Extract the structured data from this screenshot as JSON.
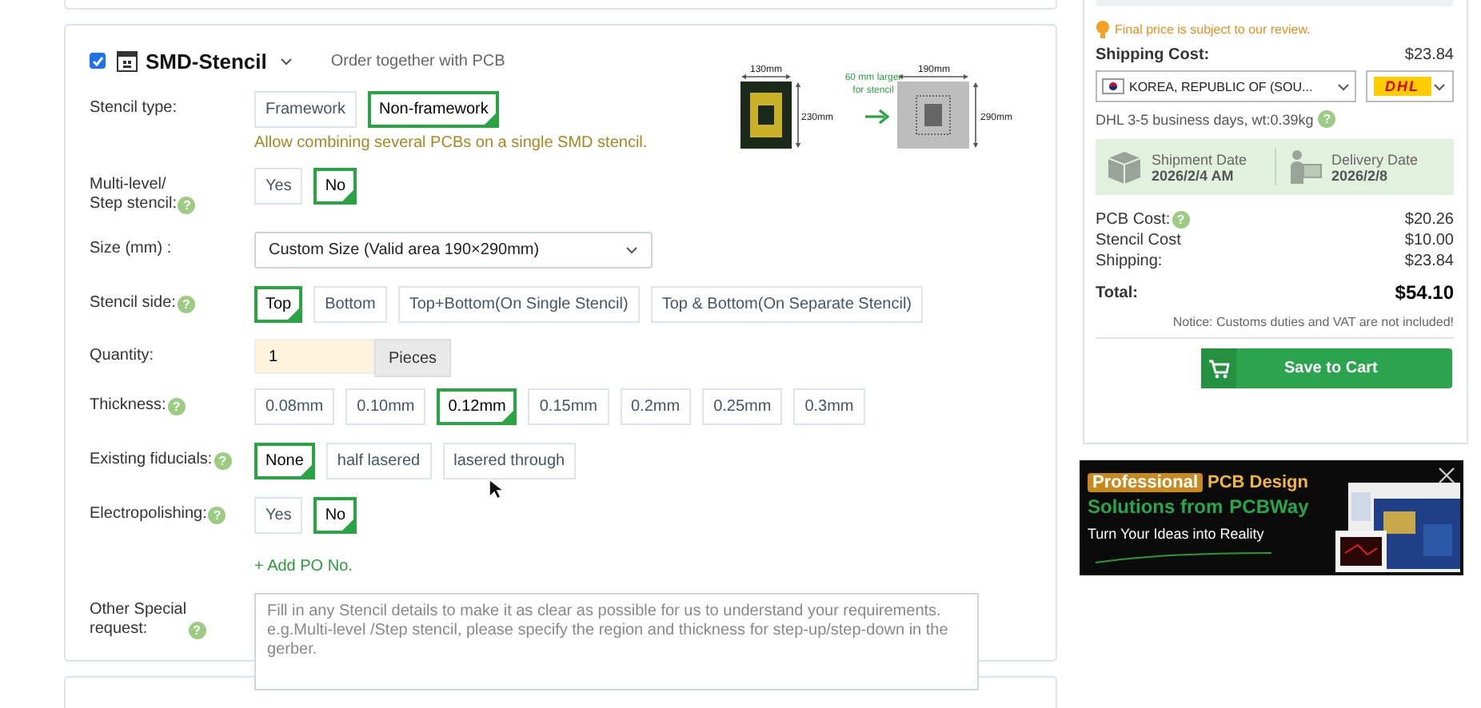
{
  "stencil": {
    "checked": true,
    "title": "SMD-Stencil",
    "subtitle": "Order together with PCB",
    "diagram": {
      "pcb_width": "130mm",
      "pcb_height": "230mm",
      "note": [
        "60 mm larger",
        "for stencil"
      ],
      "stencil_width": "190mm",
      "stencil_height": "290mm"
    },
    "fields": [
      {
        "kind": "options",
        "label": "Stencil type:",
        "options": [
          {
            "label": "Framework",
            "selected": false
          },
          {
            "label": "Non-framework",
            "selected": true
          }
        ],
        "note": "Allow combining several PCBs on a single SMD stencil."
      },
      {
        "kind": "options",
        "label": "Multi-level/\nStep stencil:",
        "help": "?",
        "options": [
          {
            "label": "Yes",
            "selected": false
          },
          {
            "label": "No",
            "selected": true
          }
        ]
      },
      {
        "kind": "select",
        "label": "Size (mm) :",
        "value": "Custom Size  (Valid area 190×290mm)"
      },
      {
        "kind": "options",
        "label": "Stencil side:",
        "help": "?",
        "options": [
          {
            "label": "Top",
            "selected": true
          },
          {
            "label": "Bottom",
            "selected": false
          },
          {
            "label": "Top+Bottom(On Single Stencil)",
            "selected": false
          },
          {
            "label": "Top & Bottom(On Separate Stencil)",
            "selected": false
          }
        ]
      },
      {
        "kind": "quantity",
        "label": "Quantity:",
        "value": "1",
        "unit": "Pieces"
      },
      {
        "kind": "options",
        "label": "Thickness:",
        "help": "?",
        "options": [
          {
            "label": "0.08mm",
            "selected": false
          },
          {
            "label": "0.10mm",
            "selected": false
          },
          {
            "label": "0.12mm",
            "selected": true
          },
          {
            "label": "0.15mm",
            "selected": false
          },
          {
            "label": "0.2mm",
            "selected": false
          },
          {
            "label": "0.25mm",
            "selected": false
          },
          {
            "label": "0.3mm",
            "selected": false
          }
        ]
      },
      {
        "kind": "options",
        "label": "Existing fiducials:",
        "help": "?",
        "options": [
          {
            "label": "None",
            "selected": true
          },
          {
            "label": "half lasered",
            "selected": false
          },
          {
            "label": "lasered through",
            "selected": false
          }
        ]
      },
      {
        "kind": "options",
        "label": "Electropolishing:",
        "help": "?",
        "options": [
          {
            "label": "Yes",
            "selected": false
          },
          {
            "label": "No",
            "selected": true
          }
        ]
      },
      {
        "kind": "link",
        "text": "+ Add PO No."
      },
      {
        "kind": "textarea",
        "label": "Other Special\nrequest:",
        "help": "?",
        "placeholder": "Fill in any Stencil details to make it as clear as possible for us to understand your requirements. e.g.Multi-level /Step stencil, please specify the region and thickness for step-up/step-down in the gerber."
      }
    ]
  },
  "summary": {
    "notice": "Final price is subject to our review.",
    "shipping_label": "Shipping Cost:",
    "shipping_value": "$23.84",
    "country": "KOREA, REPUBLIC OF (SOU...",
    "carrier": "DHL",
    "delivery_info": "DHL  3-5 business days, wt:0.39kg",
    "delivery_help": "?",
    "dates": [
      {
        "kind": "shipment",
        "label": "Shipment Date",
        "value": "2026/2/4 AM"
      },
      {
        "kind": "delivery",
        "label": "Delivery Date",
        "value": "2026/2/8"
      }
    ],
    "costs": [
      {
        "label": "PCB Cost:",
        "help": "?",
        "value": "$20.26"
      },
      {
        "label": "Stencil Cost",
        "value": "$10.00"
      },
      {
        "label": "Shipping:",
        "value": "$23.84"
      }
    ],
    "total_label": "Total:",
    "total_value": "$54.10",
    "customs_note": "Notice: Customs duties and VAT are not included!",
    "cart_button": "Save to Cart"
  },
  "ad": {
    "badge": "Professional",
    "headline": "PCB Design",
    "line_a": "Solutions from",
    "line_b": "PCBWay",
    "tagline": "Turn Your Ideas into Reality"
  }
}
